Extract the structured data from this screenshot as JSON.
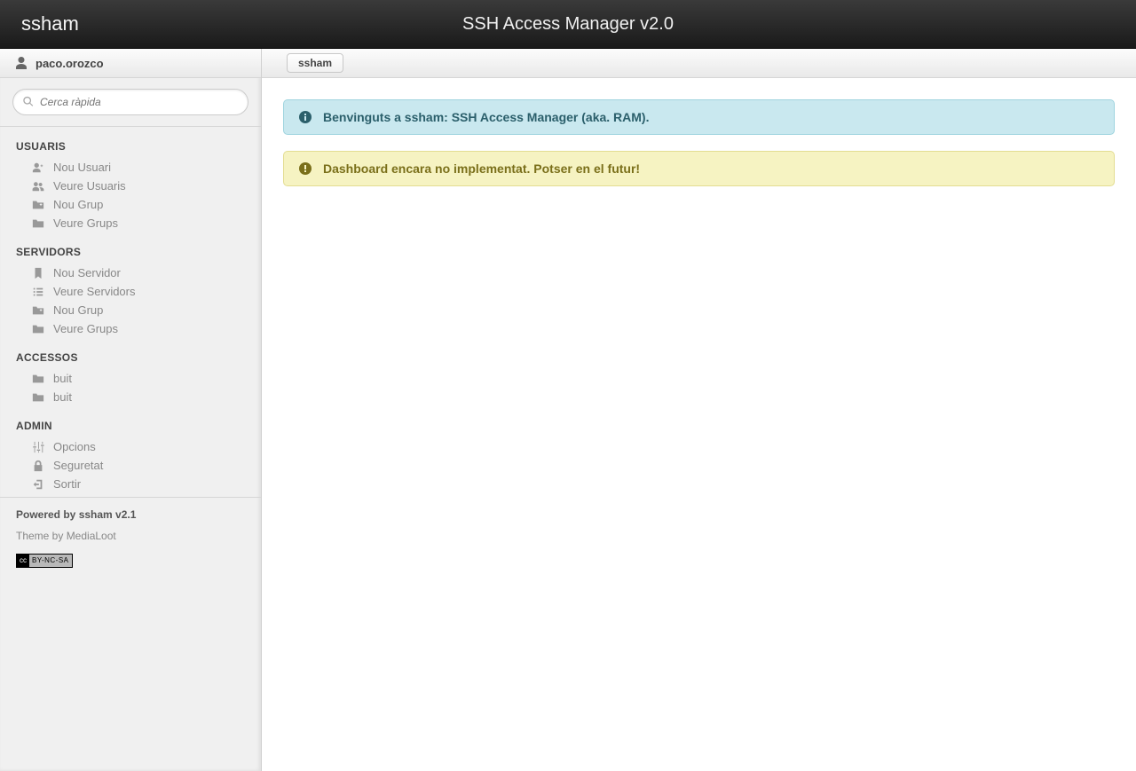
{
  "header": {
    "brand": "ssham",
    "title": "SSH Access Manager v2.0"
  },
  "user": {
    "name": "paco.orozco"
  },
  "search": {
    "placeholder": "Cerca ràpida"
  },
  "nav": {
    "groups": [
      {
        "title": "USUARIS",
        "items": [
          {
            "icon": "user-plus",
            "label": "Nou Usuari"
          },
          {
            "icon": "users",
            "label": "Veure Usuaris"
          },
          {
            "icon": "folder-plus",
            "label": "Nou Grup"
          },
          {
            "icon": "folder",
            "label": "Veure Grups"
          }
        ]
      },
      {
        "title": "SERVIDORS",
        "items": [
          {
            "icon": "bookmark",
            "label": "Nou Servidor"
          },
          {
            "icon": "list",
            "label": "Veure Servidors"
          },
          {
            "icon": "folder-plus",
            "label": "Nou Grup"
          },
          {
            "icon": "folder",
            "label": "Veure Grups"
          }
        ]
      },
      {
        "title": "ACCESSOS",
        "items": [
          {
            "icon": "folder",
            "label": "buit"
          },
          {
            "icon": "folder",
            "label": "buit"
          }
        ]
      },
      {
        "title": "ADMIN",
        "items": [
          {
            "icon": "sliders",
            "label": "Opcions"
          },
          {
            "icon": "lock",
            "label": "Seguretat"
          },
          {
            "icon": "exit",
            "label": "Sortir"
          }
        ]
      }
    ]
  },
  "footer": {
    "powered": "Powered by ssham v2.1",
    "theme": "Theme by MediaLoot",
    "cc_left": "cc",
    "cc_right": "BY-NC-SA"
  },
  "breadcrumb": {
    "label": "ssham"
  },
  "alerts": {
    "info": "Benvinguts a ssham: SSH Access Manager (aka. RAM).",
    "warn": "Dashboard encara no implementat. Potser en el futur!"
  }
}
